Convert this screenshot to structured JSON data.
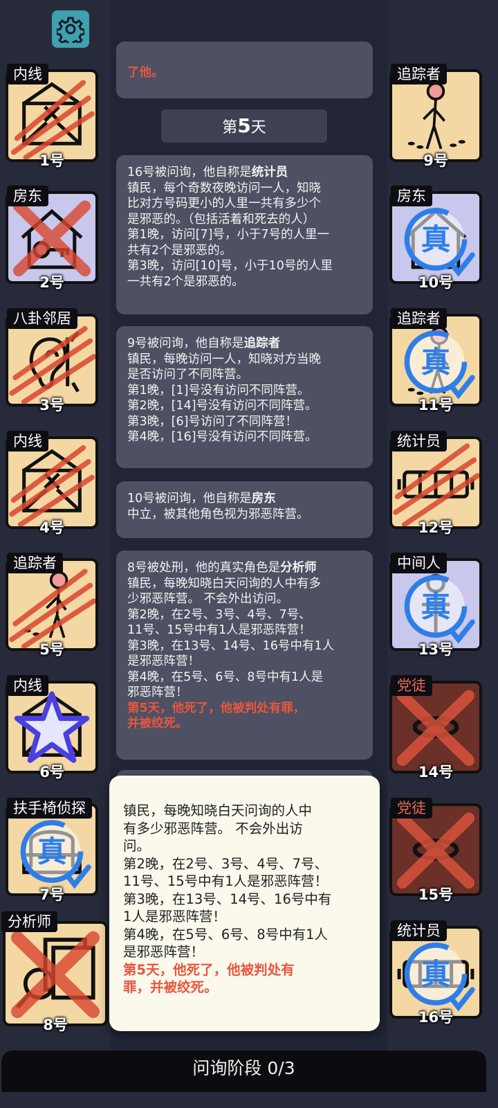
{
  "settings_icon": "gear-icon",
  "colors": {
    "accent_red": "#e8563f",
    "card_bg": "#f3d8a4",
    "card_purple": "#c8c8ec",
    "card_dark": "#6b3028",
    "verified_blue": "#2f7ee8"
  },
  "players": [
    {
      "role": "内线",
      "number": "1号",
      "icon": "envelope-x-icon",
      "status": "slashed"
    },
    {
      "role": "房东",
      "number": "2号",
      "icon": "house-key-icon",
      "status": "crossed"
    },
    {
      "role": "八卦邻居",
      "number": "3号",
      "icon": "ear-icon",
      "status": "slashed"
    },
    {
      "role": "内线",
      "number": "4号",
      "icon": "envelope-x-icon",
      "status": "slashed"
    },
    {
      "role": "追踪者",
      "number": "5号",
      "icon": "stick-figure-icon",
      "status": "slashed"
    },
    {
      "role": "内线",
      "number": "6号",
      "icon": "envelope-icon",
      "status": "starred"
    },
    {
      "role": "扶手椅侦探",
      "number": "7号",
      "icon": "armchair-icon",
      "status": "verified",
      "stamp": "真"
    },
    {
      "role": "分析师",
      "number": "8号",
      "icon": "magnifier-docs-icon",
      "status": "crossed"
    },
    {
      "role": "追踪者",
      "number": "9号",
      "icon": "stick-figure-icon",
      "status": "normal"
    },
    {
      "role": "房东",
      "number": "10号",
      "icon": "house-key-icon",
      "status": "verified",
      "stamp": "真"
    },
    {
      "role": "追踪者",
      "number": "11号",
      "icon": "stick-figure-icon",
      "status": "verified",
      "stamp": "真"
    },
    {
      "role": "统计员",
      "number": "12号",
      "icon": "counter-icon",
      "status": "slashed"
    },
    {
      "role": "中间人",
      "number": "13号",
      "icon": "middleman-icon",
      "status": "verified",
      "stamp": "真"
    },
    {
      "role": "党徒",
      "number": "14号",
      "icon": "cultist-icon",
      "status": "crossed"
    },
    {
      "role": "党徒",
      "number": "15号",
      "icon": "cultist-icon",
      "status": "crossed"
    },
    {
      "role": "统计员",
      "number": "16号",
      "icon": "counter-icon",
      "status": "verified",
      "stamp": "真"
    }
  ],
  "log": {
    "top_partial": "了他。",
    "day_header": {
      "prefix": "第",
      "number": "5",
      "suffix": "天"
    },
    "messages": [
      {
        "lead": "16号被问询，他自称是",
        "role": "统计员",
        "lines": [
          "镇民，每个奇数夜晚访问一人，知晓",
          "比对方号码更小的人里一共有多少个",
          "是邪恶的。（包括活着和死去的人）",
          "第1晚，访问[7]号，小于7号的人里一",
          "共有2个是邪恶的。",
          "第3晚，访问[10]号，小于10号的人里",
          "一共有2个是邪恶的。"
        ]
      },
      {
        "lead": "9号被问询，他自称是",
        "role": "追踪者",
        "lines": [
          "镇民，每晚访问一人，知晓对方当晚",
          "是否访问了不同阵营。",
          "第1晚，[1]号没有访问不同阵营。",
          "第2晚，[14]号没有访问不同阵营。",
          "第3晚，[6]号访问了不同阵营！",
          "第4晚，[16]号没有访问不同阵营。"
        ]
      },
      {
        "lead": "10号被问询，他自称是",
        "role": "房东",
        "lines": [
          "中立，被其他角色视为邪恶阵营。"
        ]
      },
      {
        "lead": "8号被处刑，他的真实角色是",
        "role": "分析师",
        "lines": [
          "镇民，每晚知晓白天问询的人中有多",
          "少邪恶阵营。 不会外出访问。",
          "第2晚，在2号、3号、4号、7号、",
          "11号、15号中有1人是邪恶阵营！",
          "第3晚，在13号、14号、16号中有1人",
          "是邪恶阵营！",
          "第4晚，在5号、6号、8号中有1人是",
          "邪恶阵营！"
        ],
        "red_lines": [
          "第5天，他死了，他被判处有罪，",
          "并被绞死。"
        ]
      }
    ]
  },
  "popup": {
    "lines": [
      "镇民，每晚知晓白天问询的人中",
      "有多少邪恶阵营。 不会外出访",
      "问。",
      "第2晚，在2号、3号、4号、7号、",
      "11号、15号中有1人是邪恶阵营！",
      "第3晚，在13号、14号、16号中有",
      "1人是邪恶阵营！",
      "第4晚，在5号、6号、8号中有1人",
      "是邪恶阵营！"
    ],
    "red_lines": [
      "第5天，他死了，他被判处有",
      "罪，并被绞死。"
    ]
  },
  "phase": {
    "label": "问询阶段",
    "progress": "0/3"
  }
}
